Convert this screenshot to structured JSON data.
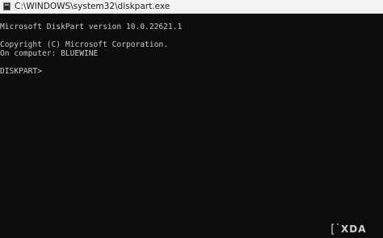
{
  "window": {
    "title": "C:\\WINDOWS\\system32\\diskpart.exe",
    "icon": "console-app-icon"
  },
  "console": {
    "lines": [
      "Microsoft DiskPart version 10.0.22621.1",
      "Copyright (C) Microsoft Corporation.",
      "On computer: BLUEWINE",
      "DISKPART> "
    ]
  },
  "watermark": {
    "text": "XDA"
  },
  "colors": {
    "console_bg": "#0c0c0c",
    "console_text": "#cccccc",
    "titlebar_bg": "#f3f3f3"
  }
}
